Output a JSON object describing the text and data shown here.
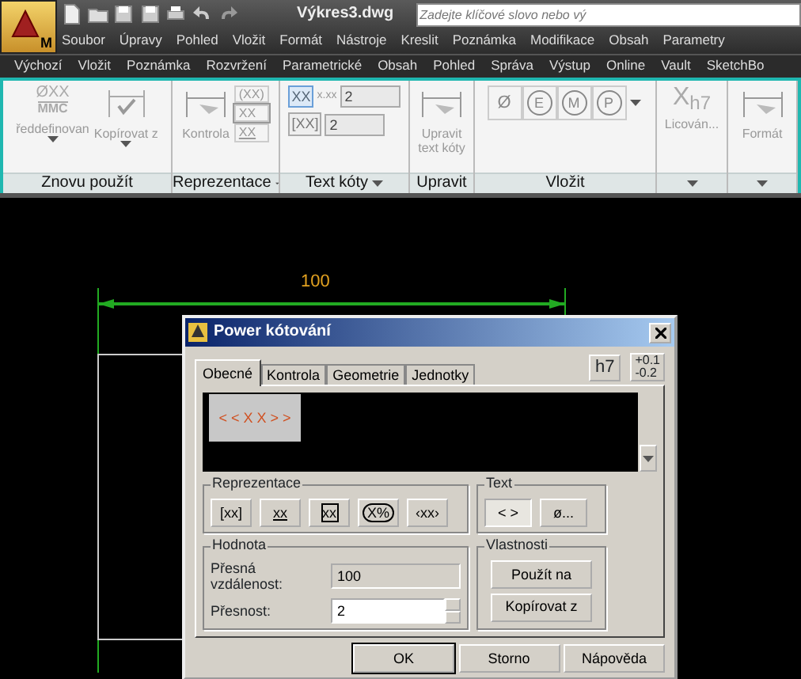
{
  "app_button": {
    "label": "M"
  },
  "title": "Výkres3.dwg",
  "search": {
    "placeholder": "Zadejte klíčové slovo nebo vý"
  },
  "menu": [
    "Soubor",
    "Úpravy",
    "Pohled",
    "Vložit",
    "Formát",
    "Nástroje",
    "Kreslit",
    "Poznámka",
    "Modifikace",
    "Obsah",
    "Parametry"
  ],
  "ribbon_tabs": [
    "Výchozí",
    "Vložit",
    "Poznámka",
    "Rozvržení",
    "Parametrické",
    "Obsah",
    "Pohled",
    "Správa",
    "Výstup",
    "Online",
    "Vault",
    "SketchBo"
  ],
  "ribbon_panels": [
    {
      "title": "Znovu použít",
      "dropdown": false,
      "tools": [
        {
          "kind": "large",
          "icon_text": "ØXX",
          "icon_subtext": "MMC",
          "label": "ředdefinovan",
          "caret": true
        },
        {
          "kind": "large",
          "label": "Kopírovat z",
          "caret": true
        }
      ]
    },
    {
      "title": "Reprezentace",
      "dropdown": true,
      "tools": [
        {
          "kind": "large",
          "label": "Kontrola",
          "caret": false
        },
        {
          "kind": "stack",
          "items": [
            {
              "text": "(XX)",
              "kind": "plain"
            },
            {
              "text": "XX",
              "kind": "boxed"
            },
            {
              "text": "XX",
              "kind": "underline"
            }
          ]
        }
      ]
    },
    {
      "title": "Text kóty",
      "dropdown": true,
      "tools": [
        {
          "kind": "spins",
          "rows": [
            {
              "icon_text": "XX",
              "selected": true,
              "label": "x.xx",
              "value": "2"
            },
            {
              "icon_text": "[XX]",
              "selected": false,
              "value": "2"
            }
          ]
        }
      ]
    },
    {
      "title": "Upravit",
      "dropdown": false,
      "tools": [
        {
          "kind": "large",
          "label": "Upravit text kóty",
          "caret": false
        }
      ]
    },
    {
      "title": "Vložit",
      "dropdown": false,
      "tools": [
        {
          "kind": "symbols",
          "symbols": [
            {
              "text": "Ø",
              "circled": false
            },
            {
              "text": "E",
              "circled": true
            },
            {
              "text": "M",
              "circled": true
            },
            {
              "text": "P",
              "circled": true
            }
          ],
          "caret": true
        }
      ]
    },
    {
      "dropdown": true,
      "tools": [
        {
          "kind": "large",
          "icon_text": "X$_{h7}$",
          "label": "Licován...",
          "caret": false
        }
      ]
    },
    {
      "dropdown": true,
      "tools": [
        {
          "kind": "large",
          "label": "Formát",
          "caret": false
        }
      ]
    }
  ],
  "canvas": {
    "dimension_text": "100"
  },
  "dialog": {
    "title": "Power kótování",
    "tabs": [
      {
        "label": "Obecné",
        "selected": true
      },
      {
        "label": "Kontrola",
        "selected": false
      },
      {
        "label": "Geometrie",
        "selected": false
      },
      {
        "label": "Jednotky",
        "selected": false
      }
    ],
    "fit_button": "h7",
    "tolerance_button": {
      "upper": "+0.1",
      "lower": "-0.2"
    },
    "preview_text": "< < X X > >",
    "representation": {
      "title": "Reprezentace",
      "buttons": [
        {
          "label": "[xx]",
          "kind": "plain"
        },
        {
          "label": "xx",
          "kind": "underline"
        },
        {
          "label": "xx",
          "kind": "boxed"
        },
        {
          "label": "X%",
          "kind": "oval"
        },
        {
          "label": "‹xx›",
          "kind": "plain"
        }
      ]
    },
    "text": {
      "title": "Text",
      "buttons": [
        {
          "label": "< >",
          "selected": true
        },
        {
          "label": "ø...",
          "selected": false
        }
      ]
    },
    "value": {
      "title": "Hodnota",
      "exact_label": "Přesná vzdálenost:",
      "exact_value": "100",
      "precision_label": "Přesnost:",
      "precision_value": "2"
    },
    "properties": {
      "title": "Vlastnosti",
      "buttons": [
        "Použít na",
        "Kopírovat z"
      ]
    },
    "buttons": [
      {
        "label": "OK",
        "default": true
      },
      {
        "label": "Storno",
        "default": false
      },
      {
        "label": "Nápověda",
        "default": false
      }
    ]
  }
}
